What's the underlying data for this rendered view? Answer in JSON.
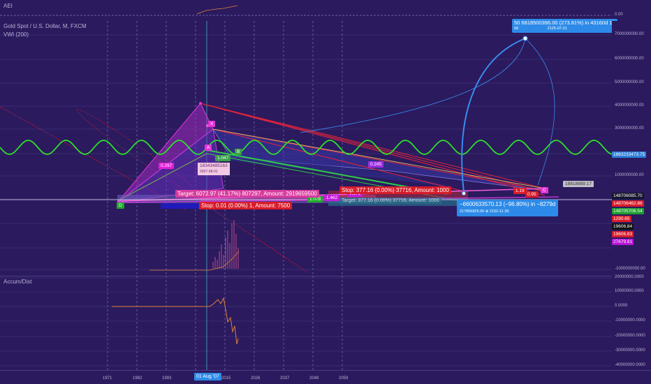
{
  "top_pane": {
    "legend": "AEI"
  },
  "main_pane": {
    "symbol_legend": "Gold Spot / U.S. Dollar, M, FXCM",
    "indicator_legend": "VWI (200)"
  },
  "bottom_pane": {
    "legend": "Accum/Dist"
  },
  "x_axis": {
    "labels": [
      "1971",
      "1982",
      "1993",
      "2015",
      "2026",
      "2037",
      "2048",
      "2059"
    ],
    "cursor_label": "01 Aug '07"
  },
  "right_axis_top": {
    "labels": [
      "0.00"
    ]
  },
  "right_axis_main": {
    "labels": [
      "7000000000.00",
      "6000000000.00",
      "5000000000.00",
      "4000000000.00",
      "3000000000.00",
      "1000000000.00",
      "-1000000000.00"
    ],
    "price_tags": [
      {
        "text": "1863233473.75",
        "color": "#2e7fd8"
      },
      {
        "text": "148706085.70",
        "color": "#16142b"
      },
      {
        "text": "148706462.86",
        "color": "#d81b2a"
      },
      {
        "text": "148705708.54",
        "color": "#1e9e2e"
      },
      {
        "text": "1290.65",
        "color": "#d81b2a"
      },
      {
        "text": "19606.84",
        "color": "#111111"
      },
      {
        "text": "19606.83",
        "color": "#d81b2a"
      },
      {
        "text": "27679.81",
        "color": "#b515d6"
      }
    ]
  },
  "right_axis_bottom": {
    "labels": [
      "20000000.0000",
      "10000000.0000",
      "0.0000",
      "-10000000.0000",
      "-20000000.0000",
      "-30000000.0000",
      "-40000000.0000"
    ]
  },
  "annotations": {
    "projection_top": {
      "line1": "50 6818500396.00 (273.81%) in 43160d 1h",
      "line2_left": "68",
      "line2_right": "2125-07-31"
    },
    "projection_bottom": {
      "line1": "−6600633570.13 (−96.80%) in −8279d",
      "line2": "217866825.90  ⊕ 2102-11-30"
    },
    "date_callout": {
      "value": "18343485163",
      "date": "2007-08-01"
    },
    "gray_callout": "18818889.17",
    "ratios": [
      {
        "text": "0.297",
        "color": "#e11fd6"
      },
      {
        "text": "1.047",
        "color": "#3aa04a"
      },
      {
        "text": "0.245",
        "color": "#9b2fe0"
      },
      {
        "text": "1.078",
        "color": "#1faa2a"
      },
      {
        "text": "1.462",
        "color": "#c41bdd"
      },
      {
        "text": "0.371",
        "color": "#c41bdd"
      },
      {
        "text": "1.19",
        "color": "#d81b2a"
      },
      {
        "text": "0.95",
        "color": "#d81b2a"
      }
    ],
    "point_labels": {
      "x": "X",
      "a": "A",
      "b": "B",
      "c": "C",
      "d": "D"
    },
    "target_long": "Target: 6072.97 (41.17%) 807297, Amount: 2919659500",
    "stop_long": "Stop: 0.01 (0.00%) 1, Amount: 7500",
    "stop_short": "Stop: 377.16 (0.00%) 37716, Amount: 1000",
    "target_short": "Target: 377.16 (0.00%) 37716, Amount: 1000"
  }
}
